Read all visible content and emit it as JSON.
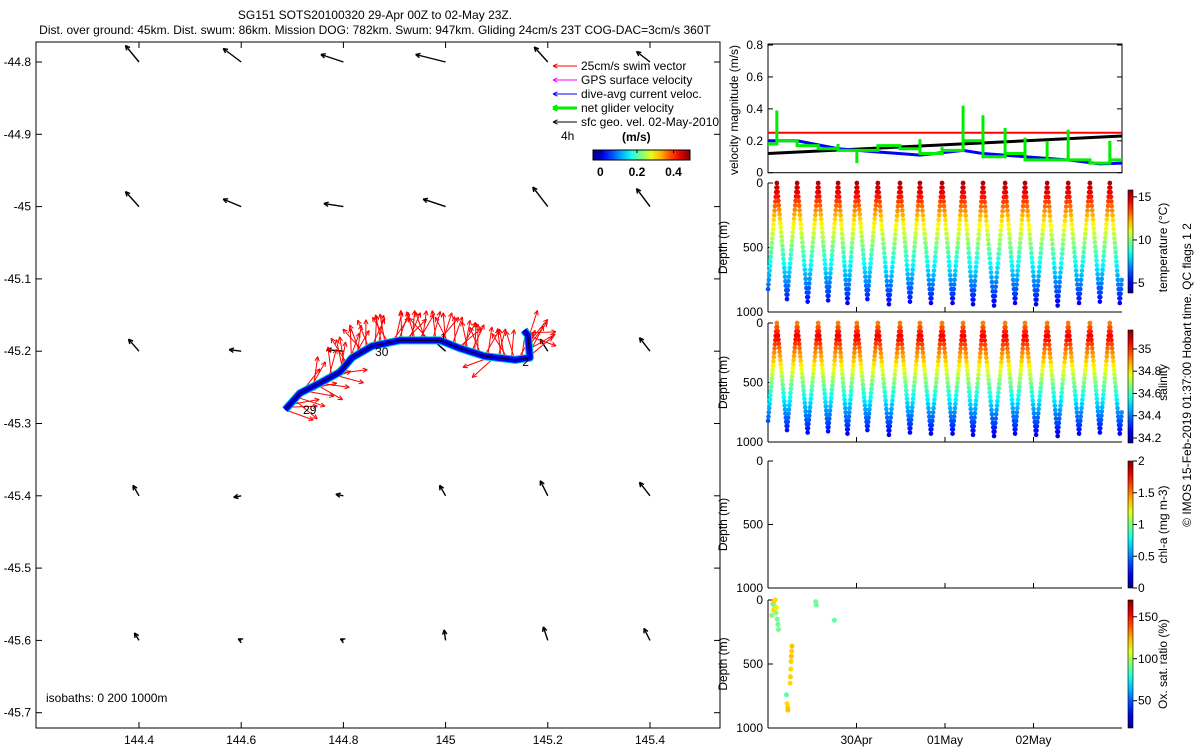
{
  "title": {
    "line1": "SG151 SOTS20100320 29-Apr 00Z to 02-May 23Z.",
    "line2": "Dist. over ground: 45km. Dist. swum: 86km. Mission DOG: 782km. Swum: 947km. Gliding 24cm/s 23T COG-DAC=3cm/s 360T"
  },
  "footer": "© IMOS 15-Feb-2019 01:37:00 Hobart time. QC flags 1  2",
  "chart_data": [
    {
      "type": "map-vectors",
      "xlim": [
        144.198,
        145.537
      ],
      "ylim": [
        -45.721,
        -44.772
      ],
      "xticks": [
        144.4,
        144.6,
        144.8,
        145,
        145.2,
        145.4
      ],
      "xtick_labels": [
        "144.4",
        "144.6",
        "144.8",
        "145",
        "145.2",
        "145.4"
      ],
      "yticks": [
        -44.8,
        -44.9,
        -45,
        -45.1,
        -45.2,
        -45.3,
        -45.4,
        -45.5,
        -45.6,
        -45.7
      ],
      "ytick_labels": [
        "-44.8",
        "-44.9",
        "-45",
        "-45.1",
        "-45.2",
        "-45.3",
        "-45.4",
        "-45.5",
        "-45.6",
        "-45.7"
      ],
      "isobaths_label": "isobaths: 0   200  1000m",
      "legend": [
        {
          "label": "25cm/s swim vector",
          "color": "#ff0000"
        },
        {
          "label": "GPS surface velocity",
          "color": "#ff00ff"
        },
        {
          "label": "dive-avg current veloc.",
          "color": "#0000ff"
        },
        {
          "label": "net glider velocity",
          "color": "#00ee00"
        },
        {
          "label": "sfc geo. vel. 02-May-2010",
          "color": "#000000"
        }
      ],
      "interval_label": "4h",
      "colorbar": {
        "label": "(m/s)",
        "range": [
          -0.04,
          0.49
        ],
        "ticks": [
          0,
          0.2,
          0.4
        ],
        "tick_labels": [
          "0",
          "0.2",
          "0.4"
        ],
        "colormap": "jet"
      },
      "track": [
        [
          144.686,
          -45.281
        ],
        [
          144.715,
          -45.258
        ],
        [
          144.754,
          -45.244
        ],
        [
          144.793,
          -45.229
        ],
        [
          144.817,
          -45.209
        ],
        [
          144.856,
          -45.193
        ],
        [
          144.911,
          -45.185
        ],
        [
          144.989,
          -45.185
        ],
        [
          145.028,
          -45.196
        ],
        [
          145.077,
          -45.207
        ],
        [
          145.136,
          -45.212
        ],
        [
          145.165,
          -45.209
        ],
        [
          145.161,
          -45.178
        ],
        [
          145.153,
          -45.171
        ]
      ],
      "day_labels": [
        {
          "text": "29",
          "lon": 144.721,
          "lat": -45.281
        },
        {
          "text": "30",
          "lon": 144.862,
          "lat": -45.201
        },
        {
          "text": "1",
          "lon": 144.989,
          "lat": -45.182
        },
        {
          "text": "2",
          "lon": 145.15,
          "lat": -45.215
        }
      ],
      "swim_speed": 0.25,
      "swim_directions_deg": [
        -20,
        10,
        -40,
        30,
        -10,
        60,
        -30,
        20,
        75,
        -15,
        80,
        100,
        70,
        60,
        110,
        90,
        65,
        80,
        100,
        55,
        70,
        45,
        85,
        60,
        110,
        75,
        50,
        95,
        70,
        40,
        80,
        65,
        90,
        60,
        -160,
        75,
        100,
        85,
        60,
        70,
        40,
        30,
        50,
        -20
      ],
      "geo_velocity": [
        {
          "lon": 144.4,
          "lat": -44.8,
          "u": -0.09,
          "v": 0.11
        },
        {
          "lon": 144.6,
          "lat": -44.8,
          "u": -0.12,
          "v": 0.09
        },
        {
          "lon": 144.8,
          "lat": -44.8,
          "u": -0.15,
          "v": 0.05
        },
        {
          "lon": 145.0,
          "lat": -44.8,
          "u": -0.2,
          "v": 0.05
        },
        {
          "lon": 145.2,
          "lat": -44.8,
          "u": -0.09,
          "v": 0.1
        },
        {
          "lon": 145.4,
          "lat": -44.8,
          "u": -0.09,
          "v": 0.07
        },
        {
          "lon": 144.4,
          "lat": -45.0,
          "u": -0.09,
          "v": 0.1
        },
        {
          "lon": 144.6,
          "lat": -45.0,
          "u": -0.12,
          "v": 0.05
        },
        {
          "lon": 144.8,
          "lat": -45.0,
          "u": -0.13,
          "v": 0.02
        },
        {
          "lon": 145.0,
          "lat": -45.0,
          "u": -0.15,
          "v": 0.05
        },
        {
          "lon": 145.2,
          "lat": -45.0,
          "u": -0.1,
          "v": 0.13
        },
        {
          "lon": 145.4,
          "lat": -45.0,
          "u": -0.09,
          "v": 0.12
        },
        {
          "lon": 144.4,
          "lat": -45.2,
          "u": -0.07,
          "v": 0.08
        },
        {
          "lon": 144.6,
          "lat": -45.2,
          "u": -0.08,
          "v": 0.01
        },
        {
          "lon": 144.8,
          "lat": -45.2,
          "u": -0.11,
          "v": 0.01
        },
        {
          "lon": 145.0,
          "lat": -45.2,
          "u": -0.09,
          "v": 0.08
        },
        {
          "lon": 145.2,
          "lat": -45.2,
          "u": -0.05,
          "v": 0.08
        },
        {
          "lon": 145.4,
          "lat": -45.2,
          "u": -0.07,
          "v": 0.09
        },
        {
          "lon": 144.4,
          "lat": -45.4,
          "u": -0.04,
          "v": 0.07
        },
        {
          "lon": 144.6,
          "lat": -45.4,
          "u": -0.05,
          "v": -0.01
        },
        {
          "lon": 144.8,
          "lat": -45.4,
          "u": -0.05,
          "v": 0.01
        },
        {
          "lon": 145.0,
          "lat": -45.4,
          "u": -0.04,
          "v": 0.07
        },
        {
          "lon": 145.2,
          "lat": -45.4,
          "u": -0.05,
          "v": 0.1
        },
        {
          "lon": 145.4,
          "lat": -45.4,
          "u": -0.07,
          "v": 0.09
        },
        {
          "lon": 144.4,
          "lat": -45.6,
          "u": -0.03,
          "v": 0.05
        },
        {
          "lon": 144.6,
          "lat": -45.6,
          "u": -0.02,
          "v": 0.01
        },
        {
          "lon": 144.8,
          "lat": -45.6,
          "u": -0.02,
          "v": 0.01
        },
        {
          "lon": 145.0,
          "lat": -45.6,
          "u": -0.01,
          "v": 0.07
        },
        {
          "lon": 145.2,
          "lat": -45.6,
          "u": -0.03,
          "v": 0.09
        },
        {
          "lon": 145.4,
          "lat": -45.6,
          "u": -0.04,
          "v": 0.08
        }
      ]
    },
    {
      "type": "line",
      "ylabel": "velocity magnitude (m/s)",
      "xlim": [
        "2010-04-29T00:00",
        "2010-05-03T00:00"
      ],
      "ylim": [
        0,
        0.8
      ],
      "yticks": [
        0,
        0.2,
        0.4,
        0.6,
        0.8
      ],
      "ytick_labels": [
        "0",
        "0.2",
        "0.4",
        "0.6",
        "0.8"
      ],
      "series": [
        {
          "name": "25cm/s swim vector",
          "color": "#ff0000",
          "points": [
            [
              "2010-04-29T00:00",
              0.25
            ],
            [
              "2010-05-03T00:00",
              0.25
            ]
          ]
        },
        {
          "name": "sfc geo. vel. 02-May-2010",
          "color": "#000000",
          "points": [
            [
              "2010-04-29T00:00",
              0.12
            ],
            [
              "2010-05-03T00:00",
              0.23
            ]
          ]
        },
        {
          "name": "dive-avg current veloc.",
          "color": "#0000ff",
          "points": [
            [
              "2010-04-29T00:00",
              0.2
            ],
            [
              "2010-04-29T07:54",
              0.2
            ],
            [
              "2010-04-29T19:00",
              0.15
            ],
            [
              "2010-04-30T05:48",
              0.13
            ],
            [
              "2010-04-30T17:12",
              0.11
            ],
            [
              "2010-05-01T04:54",
              0.14
            ],
            [
              "2010-05-01T10:18",
              0.12
            ],
            [
              "2010-05-01T21:42",
              0.1
            ],
            [
              "2010-05-02T09:24",
              0.08
            ],
            [
              "2010-05-02T18:00",
              0.055
            ],
            [
              "2010-05-03T00:00",
              0.06
            ]
          ]
        },
        {
          "name": "net glider velocity",
          "color": "#00ee00",
          "times": [
            "2010-04-29T00:00",
            "2010-04-29T02:24",
            "2010-04-29T07:54",
            "2010-04-29T13:36",
            "2010-04-29T19:00",
            "2010-04-30T00:06",
            "2010-04-30T05:48",
            "2010-04-30T11:48",
            "2010-04-30T17:12",
            "2010-04-30T23:12",
            "2010-05-01T04:54",
            "2010-05-01T10:18",
            "2010-05-01T16:18",
            "2010-05-01T21:42",
            "2010-05-02T03:42",
            "2010-05-02T09:24",
            "2010-05-02T15:18",
            "2010-05-02T20:42"
          ],
          "levels": [
            0.18,
            0.2,
            0.17,
            0.15,
            0.14,
            0.14,
            0.17,
            0.15,
            0.12,
            0.14,
            0.2,
            0.1,
            0.12,
            0.08,
            0.08,
            0.08,
            0.06,
            0.08
          ],
          "spikes": [
            null,
            0.39,
            0.2,
            null,
            0.18,
            0.06,
            0.17,
            0.16,
            0.21,
            0.16,
            0.42,
            0.36,
            0.28,
            0.22,
            0.2,
            0.27,
            null,
            0.2
          ]
        }
      ]
    },
    {
      "type": "scatter-section",
      "xlim": [
        "2010-04-29T00:00",
        "2010-05-03T00:00"
      ],
      "xticks": [
        "2010-04-30T00:00",
        "2010-05-01T00:00",
        "2010-05-02T00:00"
      ],
      "xtick_labels": [
        "30Apr",
        "01May",
        "02May"
      ],
      "ylabel": "Depth (m)",
      "ylim": [
        1000,
        0
      ],
      "ytick_labels": [
        "0",
        "500",
        "1000"
      ],
      "dives": [
        [
          "2010-04-28T21:00",
          "2010-04-29T02:24",
          930
        ],
        [
          "2010-04-29T02:24",
          "2010-04-29T07:54",
          900
        ],
        [
          "2010-04-29T07:54",
          "2010-04-29T13:36",
          920
        ],
        [
          "2010-04-29T13:36",
          "2010-04-29T19:00",
          910
        ],
        [
          "2010-04-29T19:00",
          "2010-04-30T00:06",
          930
        ],
        [
          "2010-04-30T00:06",
          "2010-04-30T05:48",
          900
        ],
        [
          "2010-04-30T05:48",
          "2010-04-30T11:48",
          940
        ],
        [
          "2010-04-30T11:48",
          "2010-04-30T17:12",
          920
        ],
        [
          "2010-04-30T17:12",
          "2010-04-30T23:12",
          930
        ],
        [
          "2010-04-30T23:12",
          "2010-05-01T04:54",
          930
        ],
        [
          "2010-05-01T04:54",
          "2010-05-01T10:18",
          940
        ],
        [
          "2010-05-01T10:18",
          "2010-05-01T16:18",
          950
        ],
        [
          "2010-05-01T16:18",
          "2010-05-01T21:42",
          930
        ],
        [
          "2010-05-01T21:42",
          "2010-05-02T03:42",
          940
        ],
        [
          "2010-05-02T03:42",
          "2010-05-02T09:24",
          950
        ],
        [
          "2010-05-02T09:24",
          "2010-05-02T15:18",
          930
        ],
        [
          "2010-05-02T15:18",
          "2010-05-02T20:42",
          920
        ],
        [
          "2010-05-02T20:42",
          "2010-05-03T02:06",
          930
        ]
      ],
      "profile_depths": [
        0,
        50,
        100,
        150,
        200,
        300,
        400,
        500,
        600,
        700,
        800,
        900,
        960
      ],
      "panels": [
        {
          "variable": "temperature",
          "cbar_label": "temperature (°C)",
          "cbar_range": [
            3.84,
            15.8
          ],
          "cbar_ticks": [
            5,
            10,
            15
          ],
          "cbar_tick_labels": [
            "5",
            "10",
            "15"
          ],
          "profile": [
            15.2,
            14.8,
            14.2,
            13.5,
            12.8,
            11.6,
            10.6,
            9.6,
            8.6,
            7.6,
            6.6,
            5.6,
            5.0
          ]
        },
        {
          "variable": "salinity",
          "cbar_label": "salinity",
          "cbar_range": [
            34.155,
            35.17
          ],
          "cbar_ticks": [
            34.2,
            34.4,
            34.6,
            34.8,
            35
          ],
          "cbar_tick_labels": [
            "34.2",
            "34.4",
            "34.6",
            "34.8",
            "35"
          ],
          "profile": [
            34.92,
            34.98,
            35.06,
            35.02,
            34.95,
            34.86,
            34.76,
            34.66,
            34.56,
            34.47,
            34.38,
            34.3,
            34.25
          ]
        },
        {
          "variable": "chl-a",
          "cbar_label": "chl-a (mg m-3)",
          "cbar_range": [
            0,
            2
          ],
          "cbar_ticks": [
            0,
            0.5,
            1,
            1.5,
            2
          ],
          "cbar_tick_labels": [
            "0",
            "0.5",
            "1",
            "1.5",
            "2"
          ]
        },
        {
          "variable": "oxygen",
          "cbar_label": "Ox. sat. ratio (%)",
          "cbar_range": [
            17.5,
            170
          ],
          "cbar_ticks": [
            50,
            100,
            150
          ],
          "cbar_tick_labels": [
            "50",
            "100",
            "150"
          ],
          "points": [
            [
              "2010-04-29T01:00",
              120,
              95
            ],
            [
              "2010-04-29T01:20",
              30,
              90
            ],
            [
              "2010-04-29T01:30",
              80,
              118
            ],
            [
              "2010-04-29T01:40",
              10,
              120
            ],
            [
              "2010-04-29T01:50",
              50,
              92
            ],
            [
              "2010-04-29T02:00",
              0,
              118
            ],
            [
              "2010-04-29T02:10",
              100,
              95
            ],
            [
              "2010-04-29T02:20",
              60,
              115
            ],
            [
              "2010-04-29T02:30",
              150,
              92
            ],
            [
              "2010-04-29T02:40",
              190,
              90
            ],
            [
              "2010-04-29T02:50",
              230,
              92
            ],
            [
              "2010-04-29T05:00",
              740,
              88
            ],
            [
              "2010-04-29T05:10",
              810,
              118
            ],
            [
              "2010-04-29T05:20",
              840,
              120
            ],
            [
              "2010-04-29T05:25",
              860,
              122
            ],
            [
              "2010-04-29T06:00",
              650,
              118
            ],
            [
              "2010-04-29T06:05",
              600,
              120
            ],
            [
              "2010-04-29T06:10",
              540,
              118
            ],
            [
              "2010-04-29T06:15",
              480,
              120
            ],
            [
              "2010-04-29T06:20",
              440,
              122
            ],
            [
              "2010-04-29T06:25",
              400,
              120
            ],
            [
              "2010-04-29T06:30",
              360,
              122
            ],
            [
              "2010-04-29T12:56",
              13,
              92
            ],
            [
              "2010-04-29T13:05",
              39,
              90
            ],
            [
              "2010-04-29T17:59",
              158,
              88
            ]
          ]
        }
      ]
    }
  ]
}
